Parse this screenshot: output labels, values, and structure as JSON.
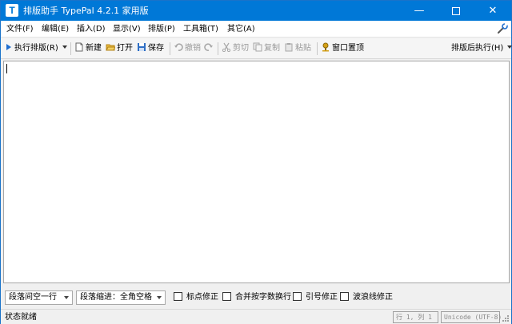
{
  "window": {
    "app_icon_letter": "T",
    "title": "排版助手 TypePal 4.2.1 家用版",
    "min_glyph": "—",
    "close_glyph": "✕"
  },
  "menu": [
    {
      "label": "文件(F)"
    },
    {
      "label": "编辑(E)"
    },
    {
      "label": "插入(D)"
    },
    {
      "label": "显示(V)"
    },
    {
      "label": "排版(P)"
    },
    {
      "label": "工具箱(T)"
    },
    {
      "label": "其它(A)"
    }
  ],
  "toolbar": {
    "run": "执行排版(R)",
    "new": "新建",
    "open": "打开",
    "save": "保存",
    "undo": "撤销",
    "cut": "剪切",
    "copy": "复制",
    "paste": "粘贴",
    "pin": "窗口置顶",
    "after_run": "排版后执行(H)"
  },
  "bottom": {
    "paragraph_spacing": "段落间空一行",
    "paragraph_indent": "段落缩进：全角空格",
    "checks": [
      {
        "label": "标点修正",
        "checked": false
      },
      {
        "label": "合并按字数换行",
        "checked": false
      },
      {
        "label": "引号修正",
        "checked": false
      },
      {
        "label": "波浪线修正",
        "checked": false
      }
    ]
  },
  "status": {
    "text": "状态就绪",
    "position": "行 1, 列 1",
    "encoding": "Unicode (UTF-8)"
  },
  "colors": {
    "titlebar": "#0078d7",
    "accent_blue": "#1f6fd0",
    "pin_gold": "#d4a017"
  }
}
